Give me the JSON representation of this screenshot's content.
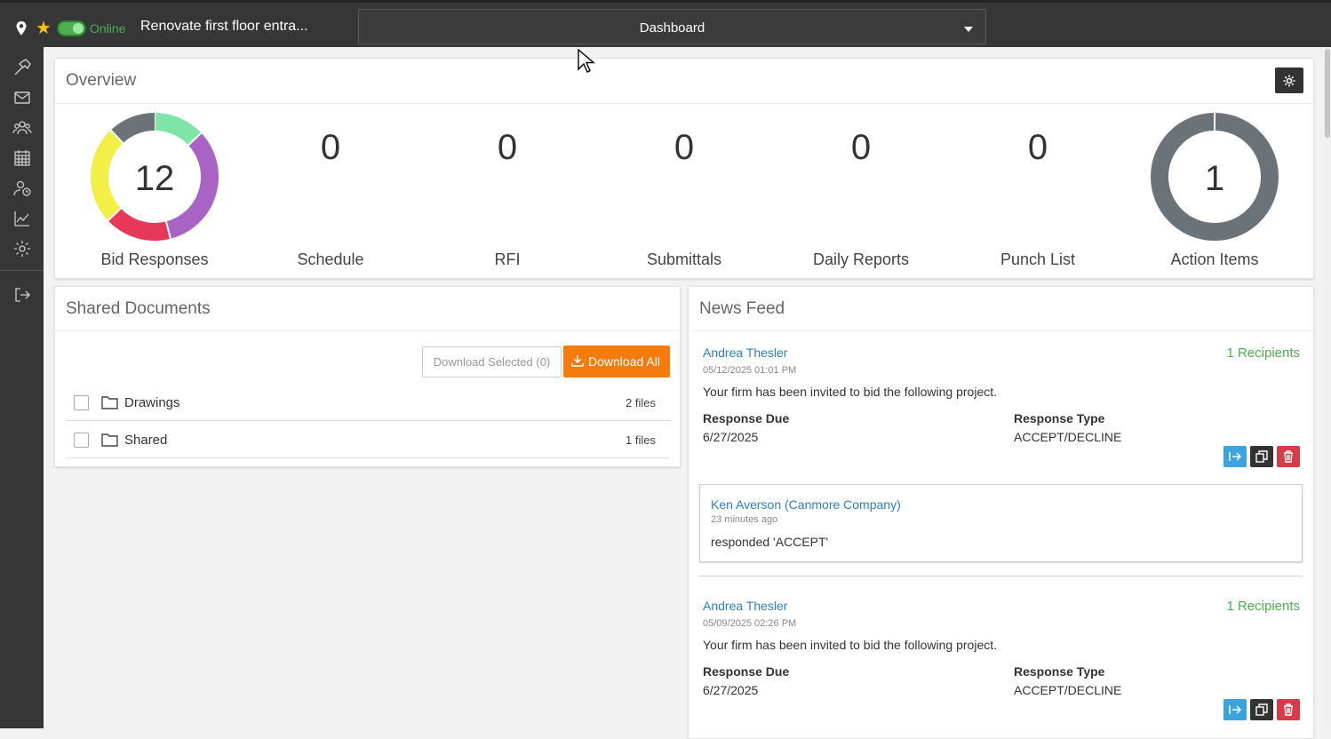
{
  "topbar": {
    "status": "Online",
    "project_title": "Renovate first floor entra...",
    "view_selector": "Dashboard",
    "icons": [
      "location-pin-icon",
      "star-icon",
      "online-toggle"
    ]
  },
  "sidebar": {
    "icons": [
      "hammer-icon",
      "mail-icon",
      "users-icon",
      "calendar-icon",
      "user-clock-icon",
      "chart-icon",
      "gear-icon",
      "logout-icon"
    ]
  },
  "overview": {
    "title": "Overview",
    "bid_responses": {
      "count": "12",
      "label": "Bid Responses"
    },
    "stats": [
      {
        "value": "0",
        "label": "Schedule"
      },
      {
        "value": "0",
        "label": "RFI"
      },
      {
        "value": "0",
        "label": "Submittals"
      },
      {
        "value": "0",
        "label": "Daily Reports"
      },
      {
        "value": "0",
        "label": "Punch List"
      }
    ],
    "action_items": {
      "count": "1",
      "label": "Action Items"
    },
    "donut_colors": [
      "#7ee5a6",
      "#a963c4",
      "#e8385a",
      "#f2ef47",
      "#6b7278"
    ],
    "donut_shares": [
      0.13,
      0.33,
      0.17,
      0.25,
      0.12
    ]
  },
  "shared_documents": {
    "title": "Shared Documents",
    "download_selected": "Download Selected (0)",
    "download_all": "Download All",
    "folders": [
      {
        "name": "Drawings",
        "count": "2 files"
      },
      {
        "name": "Shared",
        "count": "1 files"
      }
    ]
  },
  "news_feed": {
    "title": "News Feed",
    "items": [
      {
        "author": "Andrea Thesler",
        "recipients": "1 Recipients",
        "time": "05/12/2025 01:01 PM",
        "message": "Your firm has been invited to bid the following project.",
        "response_due_label": "Response Due",
        "response_due": "6/27/2025",
        "response_type_label": "Response Type",
        "response_type": "ACCEPT/DECLINE",
        "reply": {
          "author": "Ken Averson (Canmore Company)",
          "time": "23 minutes ago",
          "message": "responded 'ACCEPT'"
        }
      },
      {
        "author": "Andrea Thesler",
        "recipients": "1 Recipients",
        "time": "05/09/2025 02:26 PM",
        "message": "Your firm has been invited to bid the following project.",
        "response_due_label": "Response Due",
        "response_due": "6/27/2025",
        "response_type_label": "Response Type",
        "response_type": "ACCEPT/DECLINE"
      }
    ]
  }
}
